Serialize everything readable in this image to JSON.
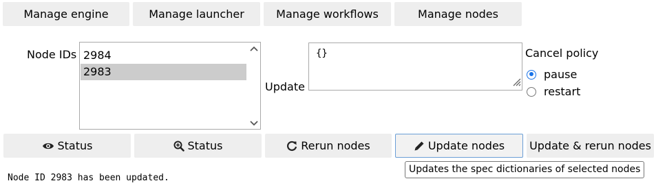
{
  "top_buttons": {
    "manage_engine": "Manage engine",
    "manage_launcher": "Manage launcher",
    "manage_workflows": "Manage workflows",
    "manage_nodes": "Manage nodes"
  },
  "node_ids": {
    "label": "Node IDs",
    "items": [
      "2984",
      "2983"
    ],
    "selected": "2983"
  },
  "update": {
    "label": "Update",
    "value": "{}"
  },
  "cancel_policy": {
    "label": "Cancel policy",
    "options": [
      "pause",
      "restart"
    ],
    "selected": "pause"
  },
  "action_buttons": {
    "status_view": {
      "label": "Status",
      "icon": "eye-icon"
    },
    "status_zoom": {
      "label": "Status",
      "icon": "zoom-in-icon"
    },
    "rerun_nodes": {
      "label": "Rerun nodes",
      "icon": "redo-icon"
    },
    "update_nodes": {
      "label": "Update nodes",
      "icon": "pencil-icon"
    },
    "update_rerun_nodes": {
      "label": "Update & rerun nodes"
    }
  },
  "tooltip": "Updates the spec dictionaries of selected nodes",
  "output": "Node ID 2983 has been updated.",
  "colors": {
    "accent": "#1a73e8",
    "button_bg": "#eeeeee",
    "selected_bg": "#cccccc",
    "focus_border": "#6a9ed6"
  }
}
